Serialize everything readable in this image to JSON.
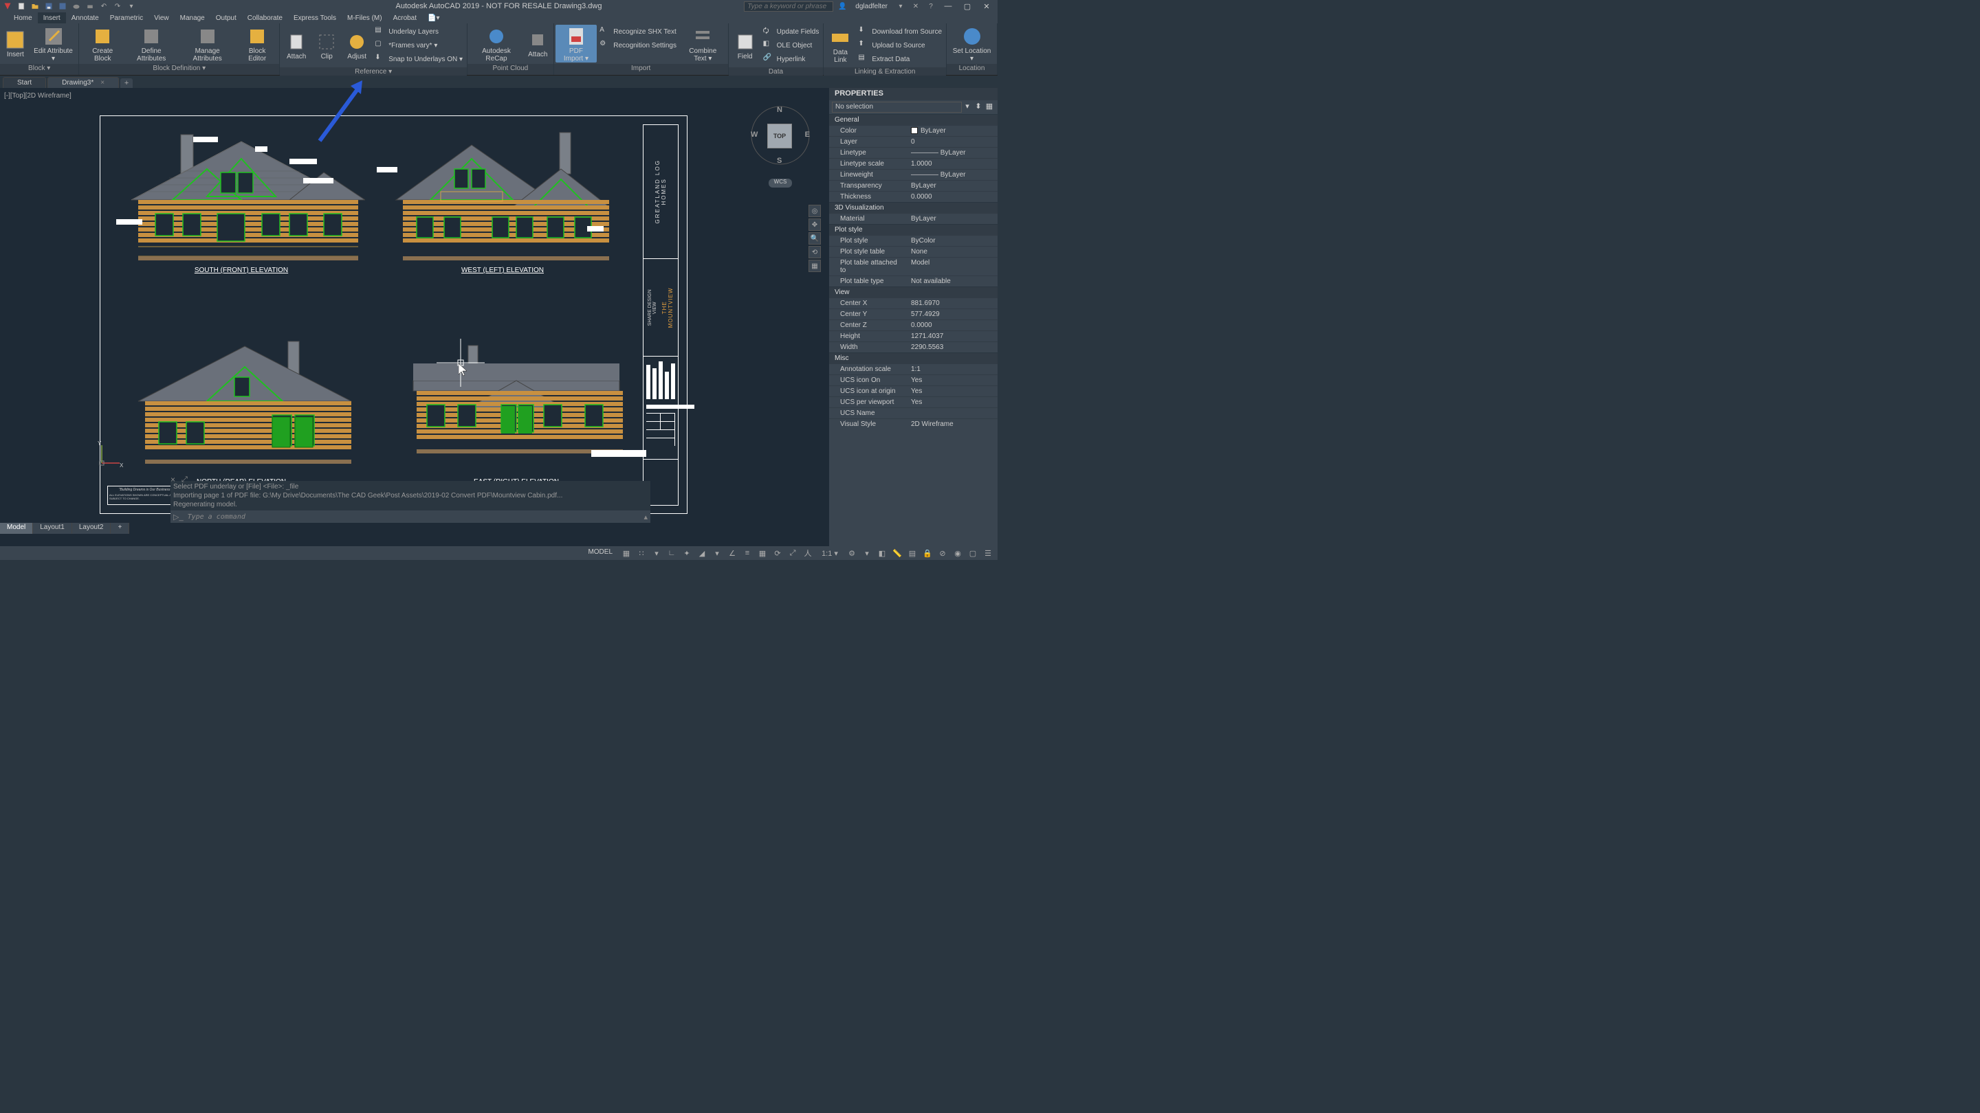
{
  "app": {
    "title": "Autodesk AutoCAD 2019 - NOT FOR RESALE   Drawing3.dwg",
    "search_placeholder": "Type a keyword or phrase",
    "user": "dgladfelter"
  },
  "menus": [
    "Home",
    "Insert",
    "Annotate",
    "Parametric",
    "View",
    "Manage",
    "Output",
    "Collaborate",
    "Express Tools",
    "M-Files (M)",
    "Acrobat"
  ],
  "active_menu": "Insert",
  "ribbon": {
    "panels": [
      {
        "title": "Block ▾",
        "items": [
          "Insert",
          "Edit Attribute ▾"
        ]
      },
      {
        "title": "Block Definition ▾",
        "items": [
          "Create Block",
          "Define Attributes",
          "Manage Attributes",
          "Block Editor"
        ]
      },
      {
        "title": "Reference ▾",
        "items": [
          "Attach",
          "Clip",
          "Adjust"
        ],
        "rows": [
          "Underlay Layers",
          "*Frames vary* ▾",
          "Snap to Underlays ON ▾"
        ]
      },
      {
        "title": "Point Cloud",
        "items": [
          "Autodesk ReCap",
          "Attach"
        ]
      },
      {
        "title": "Import",
        "items": [
          "PDF Import ▾"
        ],
        "rows": [
          "Recognize SHX Text",
          "Recognition Settings"
        ],
        "extra": [
          "Combine Text ▾"
        ]
      },
      {
        "title": "Data",
        "items": [
          "Field"
        ],
        "rows": [
          "Update Fields",
          "OLE Object",
          "Hyperlink"
        ]
      },
      {
        "title": "Linking & Extraction",
        "items": [
          "Data Link"
        ],
        "rows": [
          "Download from Source",
          "Upload to Source",
          "Extract  Data"
        ]
      },
      {
        "title": "Location",
        "items": [
          "Set Location ▾"
        ]
      }
    ]
  },
  "tabs": {
    "start": "Start",
    "file": "Drawing3*"
  },
  "viewport_label": "[-][Top][2D Wireframe]",
  "viewcube": {
    "face": "TOP",
    "n": "N",
    "s": "S",
    "e": "E",
    "w": "W",
    "wcs": "WCS"
  },
  "elevations": {
    "south": "SOUTH (FRONT) ELEVATION",
    "west": "WEST (LEFT) ELEVATION",
    "north": "NORTH (REAR) ELEVATION",
    "east": "EAST (RIGHT) ELEVATION"
  },
  "title_block": {
    "company": "GREATLAND LOG HOMES",
    "project": "THE MOUNTVIEW",
    "share": "SHARE DESIGN VIEW"
  },
  "command": {
    "line1": "Select PDF underlay or [File] <File>: _file",
    "line2": "Importing page 1 of PDF file: G:\\My Drive\\Documents\\The CAD Geek\\Post Assets\\2019-02 Convert PDF\\Mountview Cabin.pdf...",
    "line3": "Regenerating model.",
    "prompt": "Type a command"
  },
  "layout_tabs": [
    "Model",
    "Layout1",
    "Layout2"
  ],
  "properties": {
    "title": "PROPERTIES",
    "selector": "No selection",
    "sections": [
      {
        "name": "General",
        "rows": [
          {
            "label": "Color",
            "value": "ByLayer",
            "swatch": "#fff"
          },
          {
            "label": "Layer",
            "value": "0"
          },
          {
            "label": "Linetype",
            "value": "———— ByLayer"
          },
          {
            "label": "Linetype scale",
            "value": "1.0000"
          },
          {
            "label": "Lineweight",
            "value": "———— ByLayer"
          },
          {
            "label": "Transparency",
            "value": "ByLayer"
          },
          {
            "label": "Thickness",
            "value": "0.0000"
          }
        ]
      },
      {
        "name": "3D Visualization",
        "rows": [
          {
            "label": "Material",
            "value": "ByLayer"
          }
        ]
      },
      {
        "name": "Plot style",
        "rows": [
          {
            "label": "Plot style",
            "value": "ByColor"
          },
          {
            "label": "Plot style table",
            "value": "None"
          },
          {
            "label": "Plot table attached to",
            "value": "Model"
          },
          {
            "label": "Plot table type",
            "value": "Not available"
          }
        ]
      },
      {
        "name": "View",
        "rows": [
          {
            "label": "Center X",
            "value": "881.6970"
          },
          {
            "label": "Center Y",
            "value": "577.4929"
          },
          {
            "label": "Center Z",
            "value": "0.0000"
          },
          {
            "label": "Height",
            "value": "1271.4037"
          },
          {
            "label": "Width",
            "value": "2290.5563"
          }
        ]
      },
      {
        "name": "Misc",
        "rows": [
          {
            "label": "Annotation scale",
            "value": "1:1"
          },
          {
            "label": "UCS icon On",
            "value": "Yes"
          },
          {
            "label": "UCS icon at origin",
            "value": "Yes"
          },
          {
            "label": "UCS per viewport",
            "value": "Yes"
          },
          {
            "label": "UCS Name",
            "value": ""
          },
          {
            "label": "Visual Style",
            "value": "2D Wireframe"
          }
        ]
      }
    ]
  },
  "status": {
    "model": "MODEL",
    "scale": "1:1 ▾"
  },
  "drawing_note": "\"Building Dreams is Our Business\""
}
